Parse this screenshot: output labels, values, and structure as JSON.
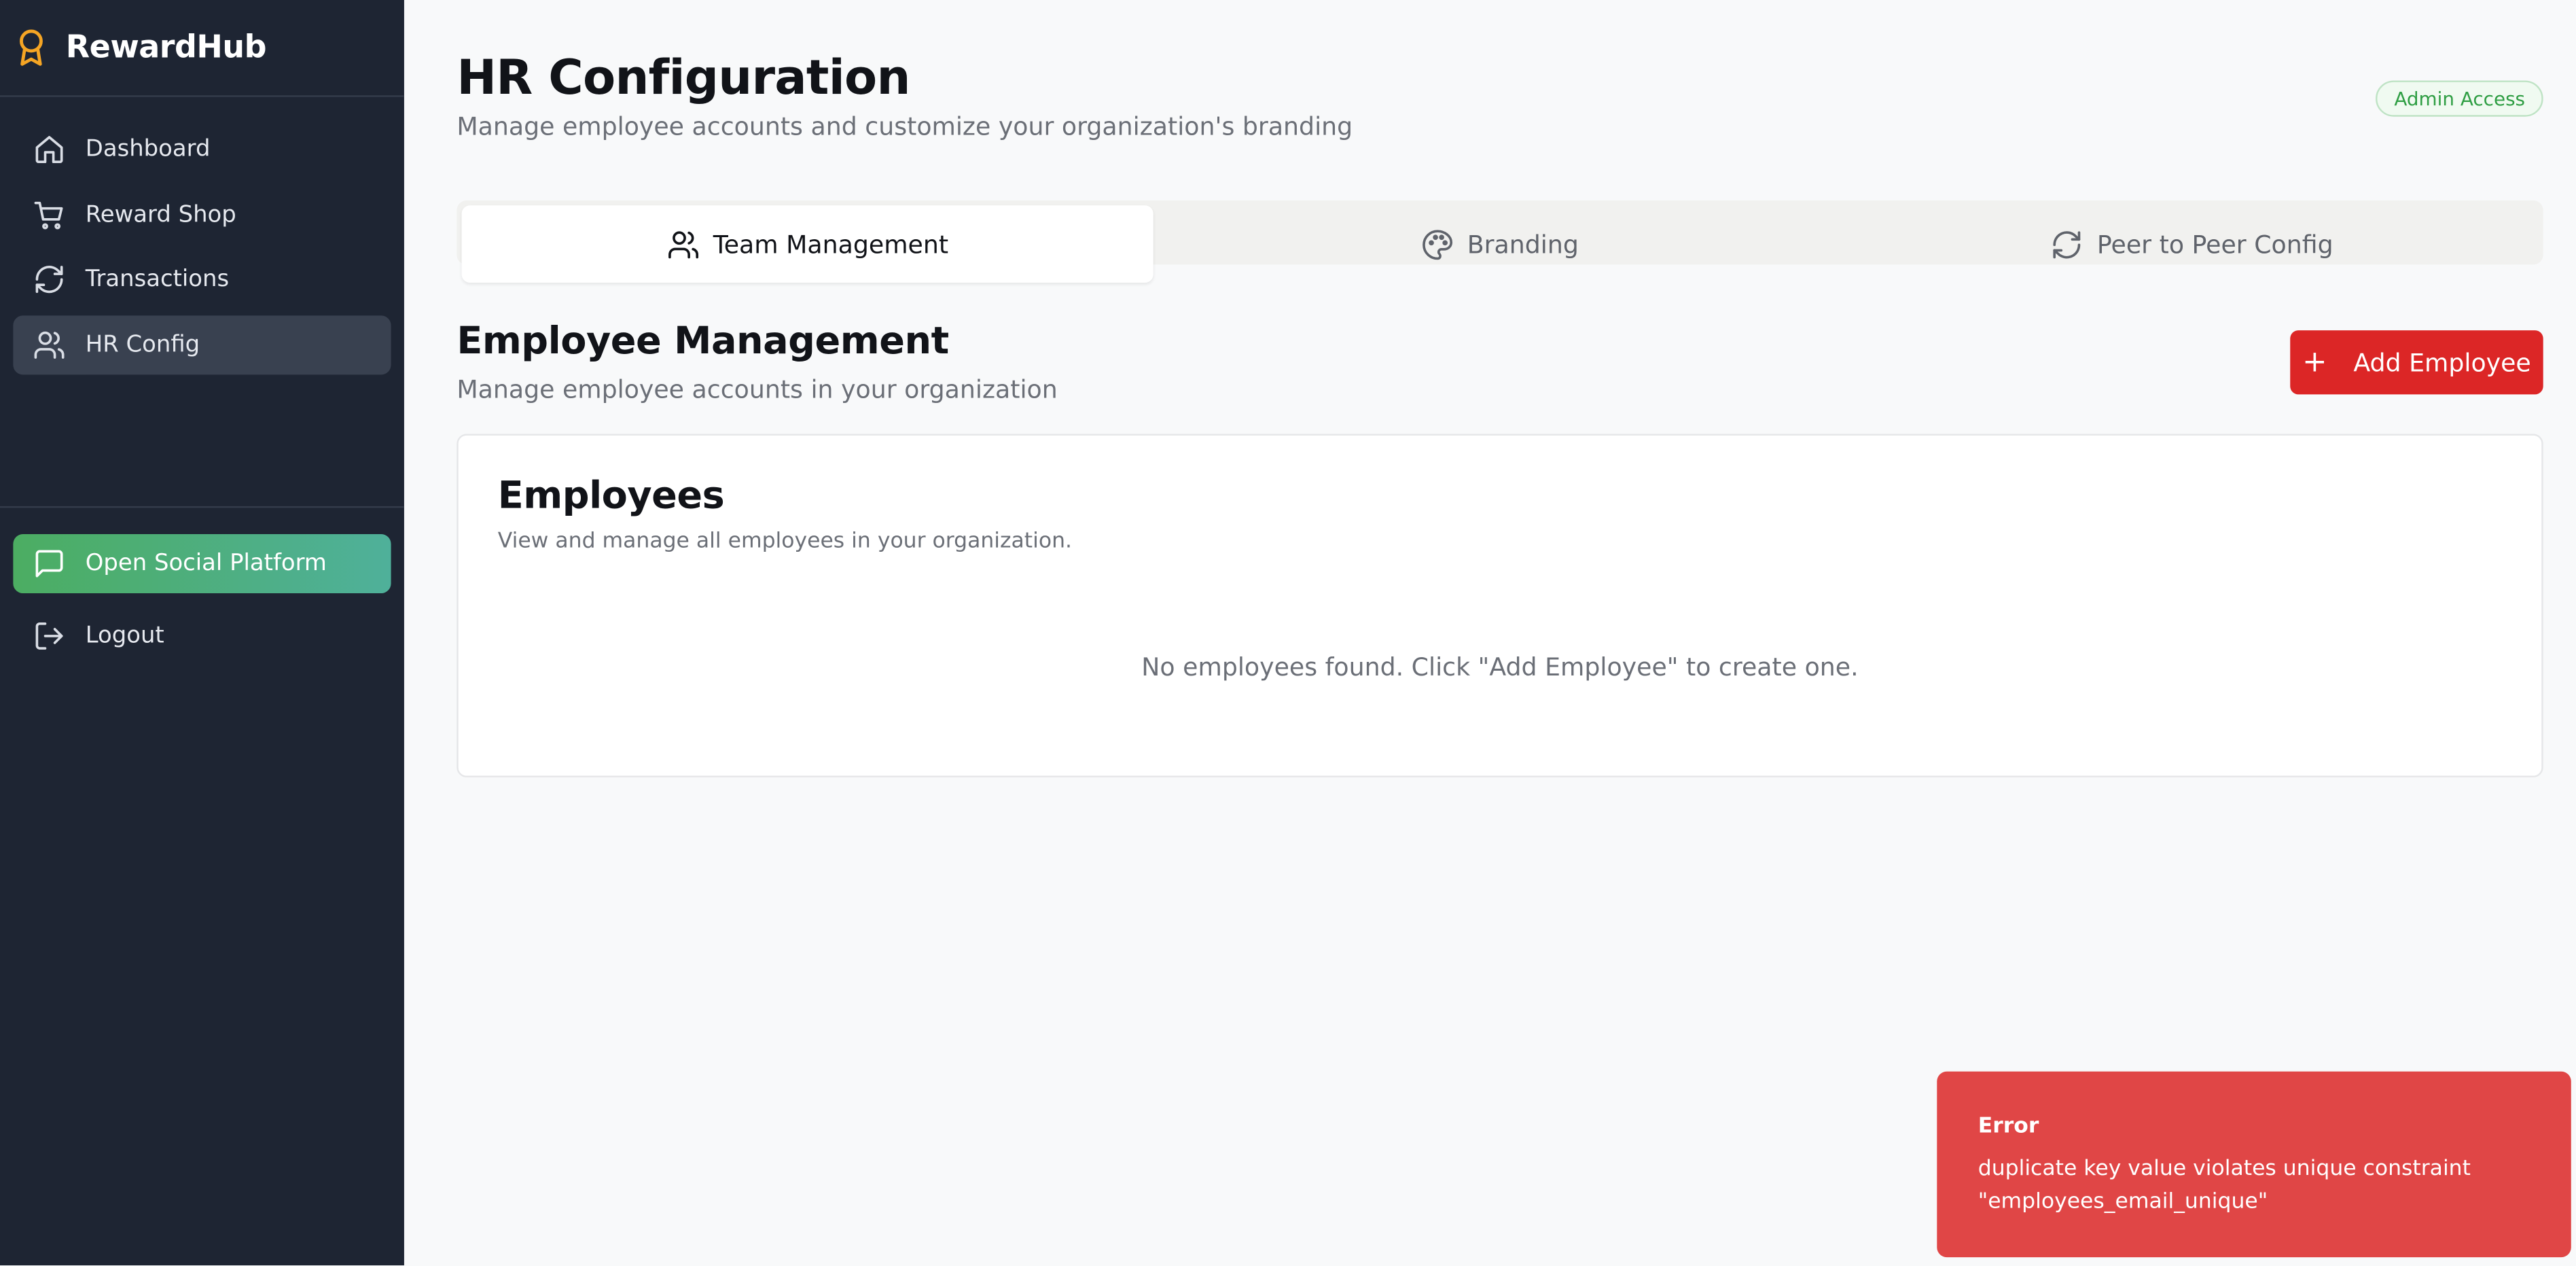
{
  "app": {
    "name": "RewardHub"
  },
  "sidebar": {
    "items": [
      {
        "label": "Dashboard",
        "icon": "home-icon"
      },
      {
        "label": "Reward Shop",
        "icon": "cart-icon"
      },
      {
        "label": "Transactions",
        "icon": "refresh-icon"
      },
      {
        "label": "HR Config",
        "icon": "users-icon",
        "active": true
      }
    ],
    "social_label": "Open Social Platform",
    "logout_label": "Logout"
  },
  "header": {
    "title": "HR Configuration",
    "subtitle": "Manage employee accounts and customize your organization's branding",
    "badge": "Admin Access"
  },
  "tabs": [
    {
      "label": "Team Management",
      "icon": "users-icon",
      "active": true
    },
    {
      "label": "Branding",
      "icon": "palette-icon"
    },
    {
      "label": "Peer to Peer Config",
      "icon": "refresh-icon"
    }
  ],
  "section": {
    "title": "Employee Management",
    "subtitle": "Manage employee accounts in your organization",
    "add_button": "Add Employee"
  },
  "card": {
    "title": "Employees",
    "subtitle": "View and manage all employees in your organization.",
    "empty": "No employees found. Click \"Add Employee\" to create one."
  },
  "toast": {
    "title": "Error",
    "message": "duplicate key value violates unique constraint \"employees_email_unique\""
  },
  "colors": {
    "sidebar_bg": "#1e2533",
    "accent_red": "#dc2626",
    "brand_gold": "#f5a524",
    "success_green": "#2f9e44",
    "toast_bg": "#e04646"
  }
}
